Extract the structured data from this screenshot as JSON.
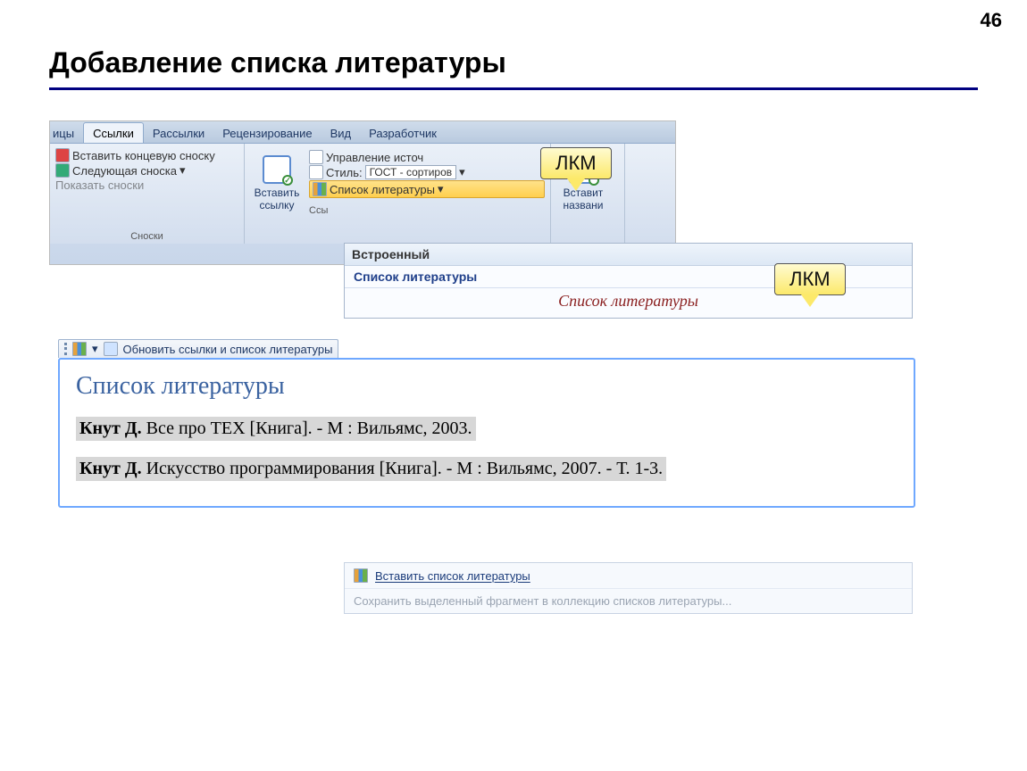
{
  "page_number": "46",
  "title": "Добавление списка литературы",
  "tabs": {
    "partial_left": "ицы",
    "active": "Ссылки",
    "t1": "Рассылки",
    "t2": "Рецензирование",
    "t3": "Вид",
    "t4": "Разработчик"
  },
  "group1": {
    "b1": "Вставить концевую сноску",
    "b2": "Следующая сноска",
    "b3": "Показать сноски",
    "label": "Сноски"
  },
  "group2": {
    "big": "Вставить\nссылку",
    "b1": "Управление источ",
    "style_lbl": "Стиль:",
    "style_val": "ГОСТ - сортиров",
    "list": "Список литературы",
    "label": "Ссы"
  },
  "group3": {
    "big": "Вставит\nназвани"
  },
  "callout1": "ЛКМ",
  "callout2": "ЛКМ",
  "gallery": {
    "header": "Встроенный",
    "sub": "Список литературы",
    "preview": "Список литературы"
  },
  "bibtab_update": "Обновить ссылки и список литературы",
  "bib_title": "Список литературы",
  "bib_items": [
    {
      "author": "Кнут Д.",
      "rest": " Все про ТЕХ [Книга]. - М : Вильямс, 2003."
    },
    {
      "author": "Кнут Д.",
      "rest": " Искусство программирования [Книга]. - М : Вильямс, 2007. - Т. 1-3."
    }
  ],
  "bottom_insert": "Вставить список литературы",
  "bottom_save": "Сохранить выделенный фрагмент в коллекцию списков литературы..."
}
